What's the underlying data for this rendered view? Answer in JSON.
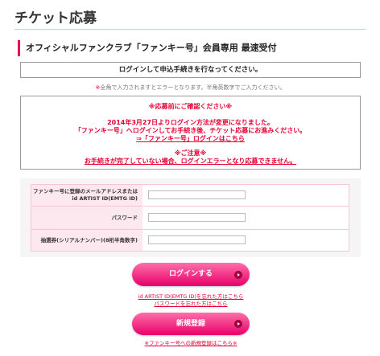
{
  "page": {
    "title": "チケット応募"
  },
  "section": {
    "heading": "オフィシャルファンクラブ「ファンキー号」会員専用 最速受付"
  },
  "login_message": "ログインして申込手続きを行なってください。",
  "width_note": {
    "asterisk": "※",
    "text": "全角で入力されますとエラーとなります。半角英数字でご入力ください。"
  },
  "notice": {
    "heading": "※応募前にご確認ください※",
    "line1": "2014年3月27日よりログイン方法が変更になりました。",
    "line2": "「ファンキー号」へログインしてお手続き後、チケット応募にお進みください。",
    "link": "⇒「ファンキー号」ログインはこちら",
    "caution_heading": "※ご注意※",
    "caution_text": "お手続きが完了していない場合、ログインエラーとなり応募できません。"
  },
  "form": {
    "email_label_line1": "ファンキー号に登録のメールアドレスまたは",
    "email_label_line2": "id ARTIST ID(EMTG ID)",
    "password_label": "パスワード",
    "serial_label": "抽選券(シリアルナンバー)(8桁半角数字)",
    "email_value": "",
    "password_value": "",
    "serial_value": ""
  },
  "buttons": {
    "login": "ログインする",
    "register": "新規登録"
  },
  "links": {
    "forgot_id": "id ARTIST ID(EMTG ID)を忘れた方はこちら",
    "forgot_password": "パスワードを忘れた方はこちら",
    "new_registration": "※ファンキー号への新規登録はこちら※"
  },
  "colors": {
    "accent": "#e60033",
    "brand_pink": "#e8005a",
    "label_bg": "#fde8ef"
  }
}
